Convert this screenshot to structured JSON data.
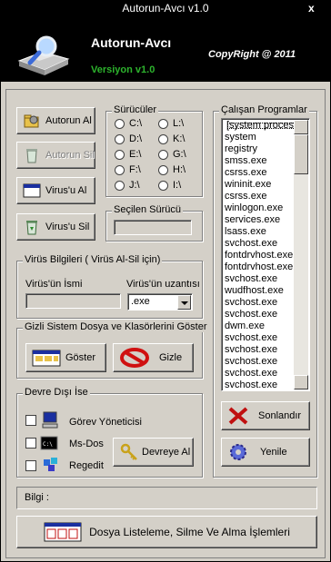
{
  "window": {
    "title": "Autorun-Avcı v1.0",
    "close": "x"
  },
  "banner": {
    "name": "Autorun-Avcı",
    "version": "Versiyon v1.0",
    "copyright": "CopyRight @ 2011",
    "logo_icon": "magnifier-drive-icon"
  },
  "actions": {
    "autorun_al": "Autorun Al",
    "autorun_sil": "Autorun Sil",
    "virus_al": "Virus'u Al",
    "virus_sil": "Virus'u Sil"
  },
  "drives": {
    "label": "Sürücüler",
    "items": [
      "C:\\",
      "L:\\",
      "D:\\",
      "K:\\",
      "E:\\",
      "G:\\",
      "F:\\",
      "H:\\",
      "J:\\",
      "I:\\"
    ]
  },
  "selected_drive": {
    "label": "Seçilen Sürücü",
    "value": ""
  },
  "virus_info": {
    "label": "Virüs Bilgileri ( Virüs Al-Sil için)",
    "name_label": "Virüs'ün İsmi",
    "name_value": "",
    "ext_label": "Virüs'ün uzantısı",
    "ext_value": ".exe"
  },
  "hidden_files": {
    "label": "Gizli Sistem Dosya ve Klasörlerini Göster",
    "show": "Göster",
    "hide": "Gizle"
  },
  "disabled": {
    "label": "Devre Dışı İse",
    "task_manager": "Görev Yöneticisi",
    "msdos": "Ms-Dos",
    "regedit": "Regedit",
    "enable": "Devreye Al"
  },
  "processes": {
    "label": "Çalışan Programlar",
    "items": [
      "[system process]",
      "system",
      "registry",
      "smss.exe",
      "csrss.exe",
      "wininit.exe",
      "csrss.exe",
      "winlogon.exe",
      "services.exe",
      "lsass.exe",
      "svchost.exe",
      "fontdrvhost.exe",
      "fontdrvhost.exe",
      "svchost.exe",
      "wudfhost.exe",
      "svchost.exe",
      "svchost.exe",
      "dwm.exe",
      "svchost.exe",
      "svchost.exe",
      "svchost.exe",
      "svchost.exe",
      "svchost.exe"
    ],
    "terminate": "Sonlandır",
    "refresh": "Yenile"
  },
  "status": {
    "label": "Bilgi :"
  },
  "bottom_button": "Dosya Listeleme, Silme Ve Alma İşlemleri",
  "colors": {
    "banner_bg": "#000000",
    "version_green": "#2db42d",
    "face": "#d4d0c8"
  }
}
